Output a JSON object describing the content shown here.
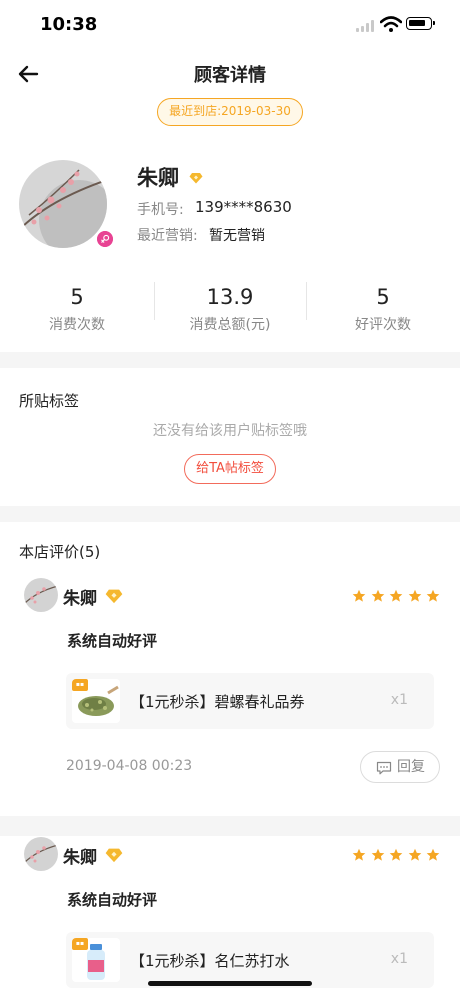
{
  "status_bar": {
    "time": "10:38"
  },
  "header": {
    "title": "顾客详情",
    "last_visit": "最近到店:2019-03-30"
  },
  "profile": {
    "name": "朱卿",
    "phone_label": "手机号:",
    "phone": "139****8630",
    "marketing_label": "最近营销:",
    "marketing_value": "暂无营销"
  },
  "stats": [
    {
      "value": "5",
      "label": "消费次数"
    },
    {
      "value": "13.9",
      "label": "消费总额(元)"
    },
    {
      "value": "5",
      "label": "好评次数"
    }
  ],
  "tags": {
    "title": "所贴标签",
    "empty_text": "还没有给该用户贴标签哦",
    "add_button": "给TA帖标签"
  },
  "reviews": {
    "title": "本店评价(5)",
    "items": [
      {
        "name": "朱卿",
        "stars": 5,
        "text": "系统自动好评",
        "product": "【1元秒杀】碧螺春礼品券",
        "qty": "x1",
        "time": "2019-04-08 00:23",
        "reply_label": "回复"
      },
      {
        "name": "朱卿",
        "stars": 5,
        "text": "系统自动好评",
        "product": "【1元秒杀】名仁苏打水",
        "qty": "x1"
      }
    ]
  },
  "colors": {
    "accent_orange": "#f5a623",
    "tag_red": "#f24e3e",
    "gender_pink": "#e84393",
    "star": "#f5a623"
  }
}
